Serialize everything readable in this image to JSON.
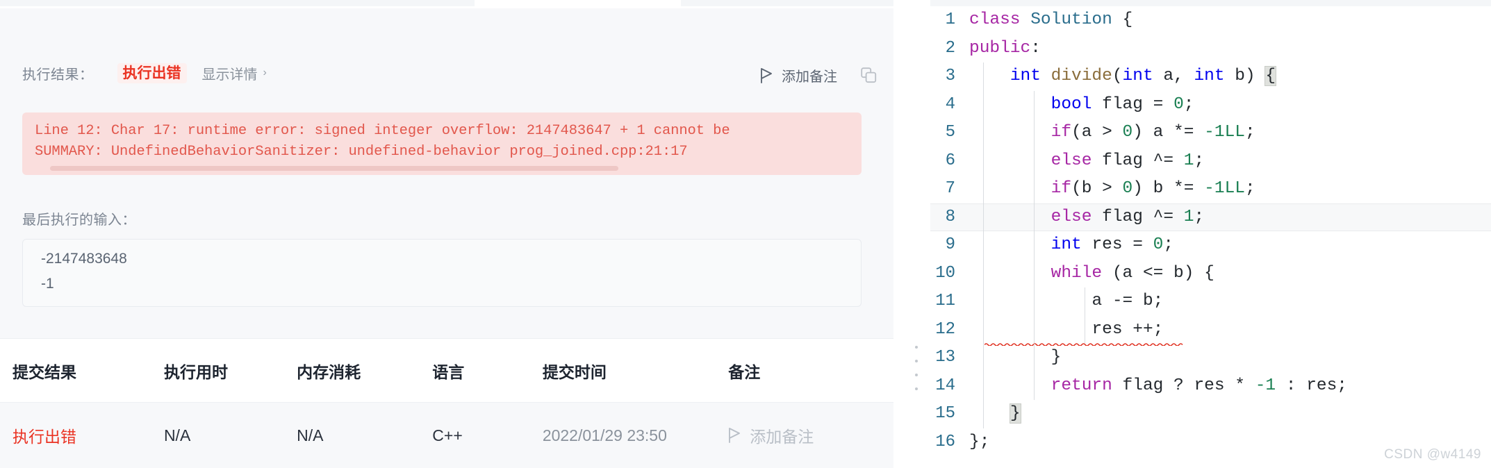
{
  "result_panel": {
    "label": "执行结果：",
    "status": "执行出错",
    "detail_link": "显示详情",
    "detail_chevron": "›",
    "add_note": "添加备注",
    "copy_icon": "copy-icon",
    "flag_icon": "flag-icon",
    "error_lines": [
      "Line 12: Char 17: runtime error: signed integer overflow: 2147483647 + 1 cannot be",
      "SUMMARY: UndefinedBehaviorSanitizer: undefined-behavior prog_joined.cpp:21:17"
    ],
    "input_label": "最后执行的输入：",
    "input_values": [
      "-2147483648",
      "-1"
    ],
    "accent_error": "#ea3323",
    "error_bg": "#fadedd",
    "error_text": "#e2574c"
  },
  "submissions_table": {
    "columns": [
      "提交结果",
      "执行用时",
      "内存消耗",
      "语言",
      "提交时间",
      "备注"
    ],
    "rows": [
      {
        "result": "执行出错",
        "runtime": "N/A",
        "memory": "N/A",
        "language": "C++",
        "submitted_at": "2022/01/29 23:50",
        "note": "添加备注"
      }
    ]
  },
  "editor": {
    "lines": [
      {
        "n": "1",
        "active": false,
        "guides": 0,
        "tokens": [
          {
            "t": "class ",
            "c": "ctrl"
          },
          {
            "t": "Solution ",
            "c": "cls"
          },
          {
            "t": "{",
            "c": "plain"
          }
        ]
      },
      {
        "n": "2",
        "active": false,
        "guides": 0,
        "tokens": [
          {
            "t": "public",
            "c": "ctrl"
          },
          {
            "t": ":",
            "c": "plain"
          }
        ]
      },
      {
        "n": "3",
        "active": false,
        "guides": 1,
        "tokens": [
          {
            "t": "    ",
            "c": "plain"
          },
          {
            "t": "int ",
            "c": "kw"
          },
          {
            "t": "divide",
            "c": "fn"
          },
          {
            "t": "(",
            "c": "plain"
          },
          {
            "t": "int ",
            "c": "kw"
          },
          {
            "t": "a, ",
            "c": "plain"
          },
          {
            "t": "int ",
            "c": "kw"
          },
          {
            "t": "b) ",
            "c": "plain"
          },
          {
            "t": "{",
            "c": "brace"
          }
        ]
      },
      {
        "n": "4",
        "active": false,
        "guides": 2,
        "tokens": [
          {
            "t": "        ",
            "c": "plain"
          },
          {
            "t": "bool ",
            "c": "kw"
          },
          {
            "t": "flag = ",
            "c": "plain"
          },
          {
            "t": "0",
            "c": "num"
          },
          {
            "t": ";",
            "c": "plain"
          }
        ]
      },
      {
        "n": "5",
        "active": false,
        "guides": 2,
        "tokens": [
          {
            "t": "        ",
            "c": "plain"
          },
          {
            "t": "if",
            "c": "ctrl"
          },
          {
            "t": "(a > ",
            "c": "plain"
          },
          {
            "t": "0",
            "c": "num"
          },
          {
            "t": ") a *= ",
            "c": "plain"
          },
          {
            "t": "-1LL",
            "c": "num"
          },
          {
            "t": ";",
            "c": "plain"
          }
        ]
      },
      {
        "n": "6",
        "active": false,
        "guides": 2,
        "tokens": [
          {
            "t": "        ",
            "c": "plain"
          },
          {
            "t": "else",
            "c": "ctrl"
          },
          {
            "t": " flag ^= ",
            "c": "plain"
          },
          {
            "t": "1",
            "c": "num"
          },
          {
            "t": ";",
            "c": "plain"
          }
        ]
      },
      {
        "n": "7",
        "active": false,
        "guides": 2,
        "tokens": [
          {
            "t": "        ",
            "c": "plain"
          },
          {
            "t": "if",
            "c": "ctrl"
          },
          {
            "t": "(b > ",
            "c": "plain"
          },
          {
            "t": "0",
            "c": "num"
          },
          {
            "t": ") b *= ",
            "c": "plain"
          },
          {
            "t": "-1LL",
            "c": "num"
          },
          {
            "t": ";",
            "c": "plain"
          }
        ]
      },
      {
        "n": "8",
        "active": true,
        "guides": 2,
        "tokens": [
          {
            "t": "        ",
            "c": "plain"
          },
          {
            "t": "else",
            "c": "ctrl"
          },
          {
            "t": " flag ^= ",
            "c": "plain"
          },
          {
            "t": "1",
            "c": "num"
          },
          {
            "t": ";",
            "c": "plain"
          }
        ]
      },
      {
        "n": "9",
        "active": false,
        "guides": 2,
        "tokens": [
          {
            "t": "        ",
            "c": "plain"
          },
          {
            "t": "int ",
            "c": "kw"
          },
          {
            "t": "res = ",
            "c": "plain"
          },
          {
            "t": "0",
            "c": "num"
          },
          {
            "t": ";",
            "c": "plain"
          }
        ]
      },
      {
        "n": "10",
        "active": false,
        "guides": 2,
        "tokens": [
          {
            "t": "        ",
            "c": "plain"
          },
          {
            "t": "while",
            "c": "ctrl"
          },
          {
            "t": " (a <= b) {",
            "c": "plain"
          }
        ]
      },
      {
        "n": "11",
        "active": false,
        "guides": 3,
        "tokens": [
          {
            "t": "            ",
            "c": "plain"
          },
          {
            "t": "a -= b;",
            "c": "plain"
          }
        ]
      },
      {
        "n": "12",
        "active": false,
        "guides": 3,
        "squiggle": true,
        "tokens": [
          {
            "t": "            ",
            "c": "plain"
          },
          {
            "t": "res ++;",
            "c": "plain"
          }
        ]
      },
      {
        "n": "13",
        "active": false,
        "guides": 2,
        "tokens": [
          {
            "t": "        ",
            "c": "plain"
          },
          {
            "t": "}",
            "c": "plain"
          }
        ]
      },
      {
        "n": "14",
        "active": false,
        "guides": 2,
        "tokens": [
          {
            "t": "        ",
            "c": "plain"
          },
          {
            "t": "return",
            "c": "ctrl"
          },
          {
            "t": " flag ? res * ",
            "c": "plain"
          },
          {
            "t": "-1",
            "c": "num"
          },
          {
            "t": " : res;",
            "c": "plain"
          }
        ]
      },
      {
        "n": "15",
        "active": false,
        "guides": 1,
        "tokens": [
          {
            "t": "    ",
            "c": "plain"
          },
          {
            "t": "}",
            "c": "brace"
          }
        ]
      },
      {
        "n": "16",
        "active": false,
        "guides": 0,
        "tokens": [
          {
            "t": "};",
            "c": "plain"
          }
        ]
      }
    ],
    "watermark": "CSDN @w4149"
  }
}
